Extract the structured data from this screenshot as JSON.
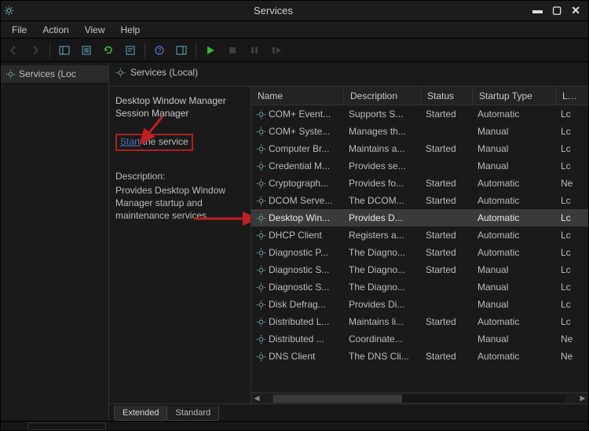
{
  "window": {
    "title": "Services"
  },
  "menubar": [
    "File",
    "Action",
    "View",
    "Help"
  ],
  "nav": {
    "label": "Services (Loc"
  },
  "header": {
    "label": "Services (Local)"
  },
  "detail": {
    "title": "Desktop Window Manager Session Manager",
    "start_link": "Start",
    "start_suffix": " the service",
    "desc_label": "Description:",
    "desc_body": "Provides Desktop Window Manager startup and maintenance services"
  },
  "columns": {
    "name": "Name",
    "desc": "Description",
    "status": "Status",
    "startup": "Startup Type",
    "logon": "Lo"
  },
  "rows": [
    {
      "name": "COM+ Event...",
      "desc": "Supports S...",
      "status": "Started",
      "startup": "Automatic",
      "logon": "Lc"
    },
    {
      "name": "COM+ Syste...",
      "desc": "Manages th...",
      "status": "",
      "startup": "Manual",
      "logon": "Lc"
    },
    {
      "name": "Computer Br...",
      "desc": "Maintains a...",
      "status": "Started",
      "startup": "Manual",
      "logon": "Lc"
    },
    {
      "name": "Credential M...",
      "desc": "Provides se...",
      "status": "",
      "startup": "Manual",
      "logon": "Lc"
    },
    {
      "name": "Cryptograph...",
      "desc": "Provides fo...",
      "status": "Started",
      "startup": "Automatic",
      "logon": "Ne"
    },
    {
      "name": "DCOM Serve...",
      "desc": "The DCOM...",
      "status": "Started",
      "startup": "Automatic",
      "logon": "Lc"
    },
    {
      "name": "Desktop Win...",
      "desc": "Provides D...",
      "status": "",
      "startup": "Automatic",
      "logon": "Lc",
      "selected": true
    },
    {
      "name": "DHCP Client",
      "desc": "Registers a...",
      "status": "Started",
      "startup": "Automatic",
      "logon": "Lc"
    },
    {
      "name": "Diagnostic P...",
      "desc": "The Diagno...",
      "status": "Started",
      "startup": "Automatic",
      "logon": "Lc"
    },
    {
      "name": "Diagnostic S...",
      "desc": "The Diagno...",
      "status": "Started",
      "startup": "Manual",
      "logon": "Lc"
    },
    {
      "name": "Diagnostic S...",
      "desc": "The Diagno...",
      "status": "",
      "startup": "Manual",
      "logon": "Lc"
    },
    {
      "name": "Disk Defrag...",
      "desc": "Provides Di...",
      "status": "",
      "startup": "Manual",
      "logon": "Lc"
    },
    {
      "name": "Distributed L...",
      "desc": "Maintains li...",
      "status": "Started",
      "startup": "Automatic",
      "logon": "Lc"
    },
    {
      "name": "Distributed ...",
      "desc": "Coordinate...",
      "status": "",
      "startup": "Manual",
      "logon": "Ne"
    },
    {
      "name": "DNS Client",
      "desc": "The DNS Cli...",
      "status": "Started",
      "startup": "Automatic",
      "logon": "Ne"
    }
  ],
  "tabs": {
    "extended": "Extended",
    "standard": "Standard"
  }
}
